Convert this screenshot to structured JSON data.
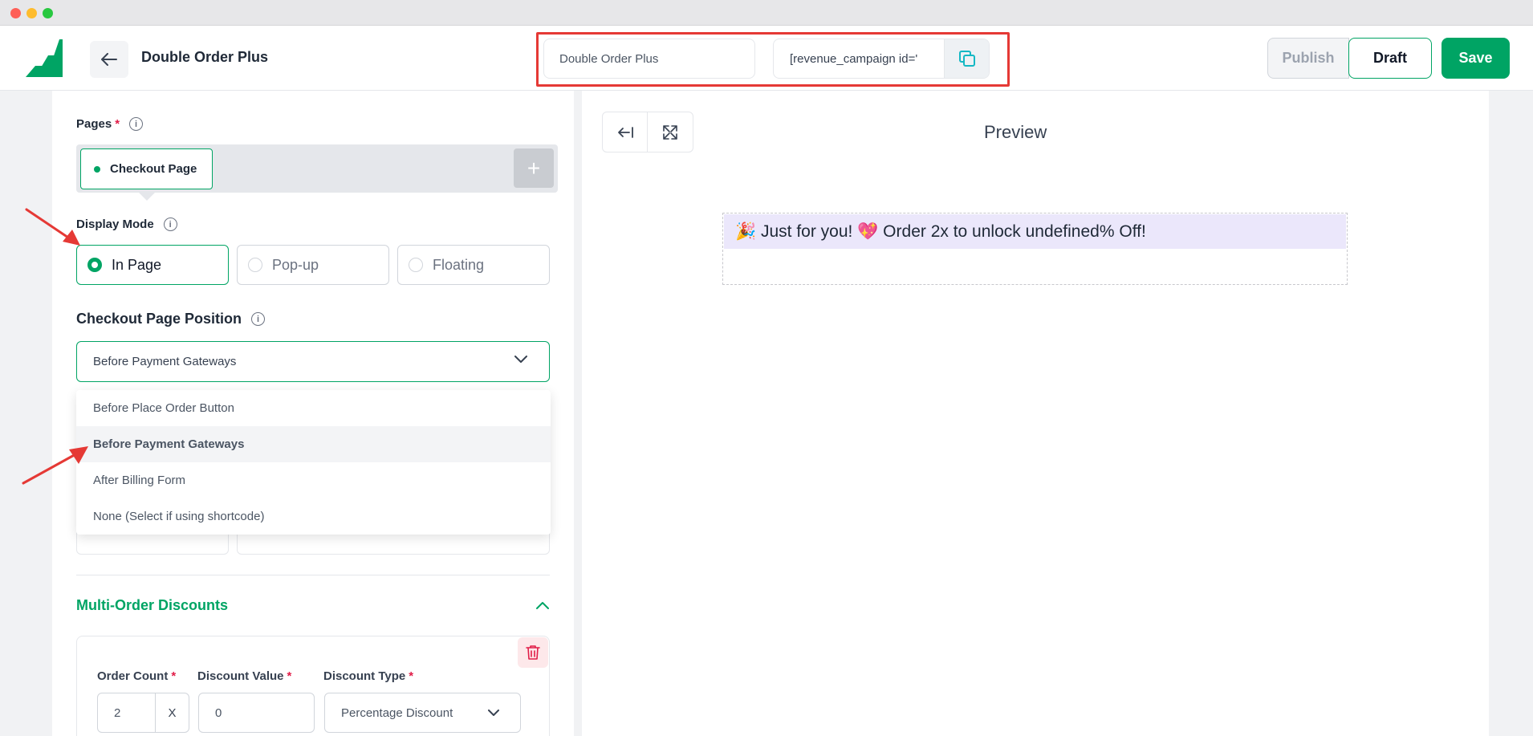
{
  "window": {
    "controls": [
      "close",
      "minimize",
      "maximize"
    ]
  },
  "header": {
    "title": "Double Order Plus",
    "campaign_name_value": "Double Order Plus",
    "shortcode_value": "[revenue_campaign id='",
    "publish_label": "Publish",
    "draft_label": "Draft",
    "save_label": "Save"
  },
  "settings": {
    "pages_label": "Pages",
    "pages": [
      {
        "label": "Checkout Page"
      }
    ],
    "add_page_icon": "plus-icon",
    "display_mode_label": "Display Mode",
    "display_modes": [
      {
        "label": "In Page",
        "selected": true
      },
      {
        "label": "Pop-up",
        "selected": false
      },
      {
        "label": "Floating",
        "selected": false
      }
    ],
    "position_label": "Checkout Page Position",
    "position_selected": "Before Payment Gateways",
    "position_options": [
      {
        "label": "Before Place Order Button"
      },
      {
        "label": "Before Payment Gateways"
      },
      {
        "label": "After Billing Form"
      },
      {
        "label": "None (Select if using shortcode)"
      }
    ],
    "multi_order_title": "Multi-Order Discounts",
    "tier": {
      "order_count_label": "Order Count",
      "order_count_value": "2",
      "order_count_suffix": "X",
      "discount_value_label": "Discount Value",
      "discount_value": "0",
      "discount_type_label": "Discount Type",
      "discount_type_value": "Percentage Discount"
    }
  },
  "preview": {
    "title": "Preview",
    "banner_text": "🎉 Just for you! 💖 Order 2x to unlock undefined% Off!"
  },
  "colors": {
    "accent": "#00a464",
    "annotation": "#e53935",
    "banner_bg": "#ebe7fb"
  }
}
